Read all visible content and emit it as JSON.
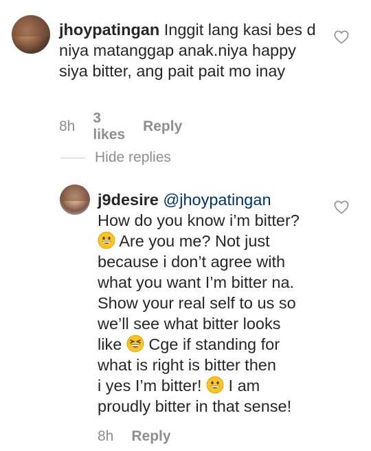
{
  "comments": [
    {
      "username": "jhoypatingan",
      "text": "Inggit lang kasi bes d niya matanggap anak.niya happy siya bitter, ang pait pait mo inay",
      "time": "8h",
      "likes": "3 likes",
      "reply_label": "Reply"
    }
  ],
  "hide_replies_label": "Hide replies",
  "reply": {
    "username": "j9desire",
    "mention": "@jhoypatingan",
    "lines": [
      "How do you know i’m bitter?",
      "Are you me? Not just",
      "because i don’t agree with",
      "what you want I’m bitter na.",
      "Show your real self to us so",
      "we’ll see what bitter looks",
      "like",
      "Cge if standing for",
      "what is right is bitter then",
      "i yes I’m bitter!",
      "I am",
      "proudly bitter in that sense!"
    ],
    "time": "8h",
    "reply_label": "Reply"
  },
  "icons": {
    "like": "heart-outline-icon",
    "emoji_grin": "grinning-face-emoji",
    "emoji_squint": "squinting-laughing-face-emoji"
  },
  "colors": {
    "text": "#262626",
    "secondary": "#8e8e8e",
    "mention": "#003569"
  }
}
